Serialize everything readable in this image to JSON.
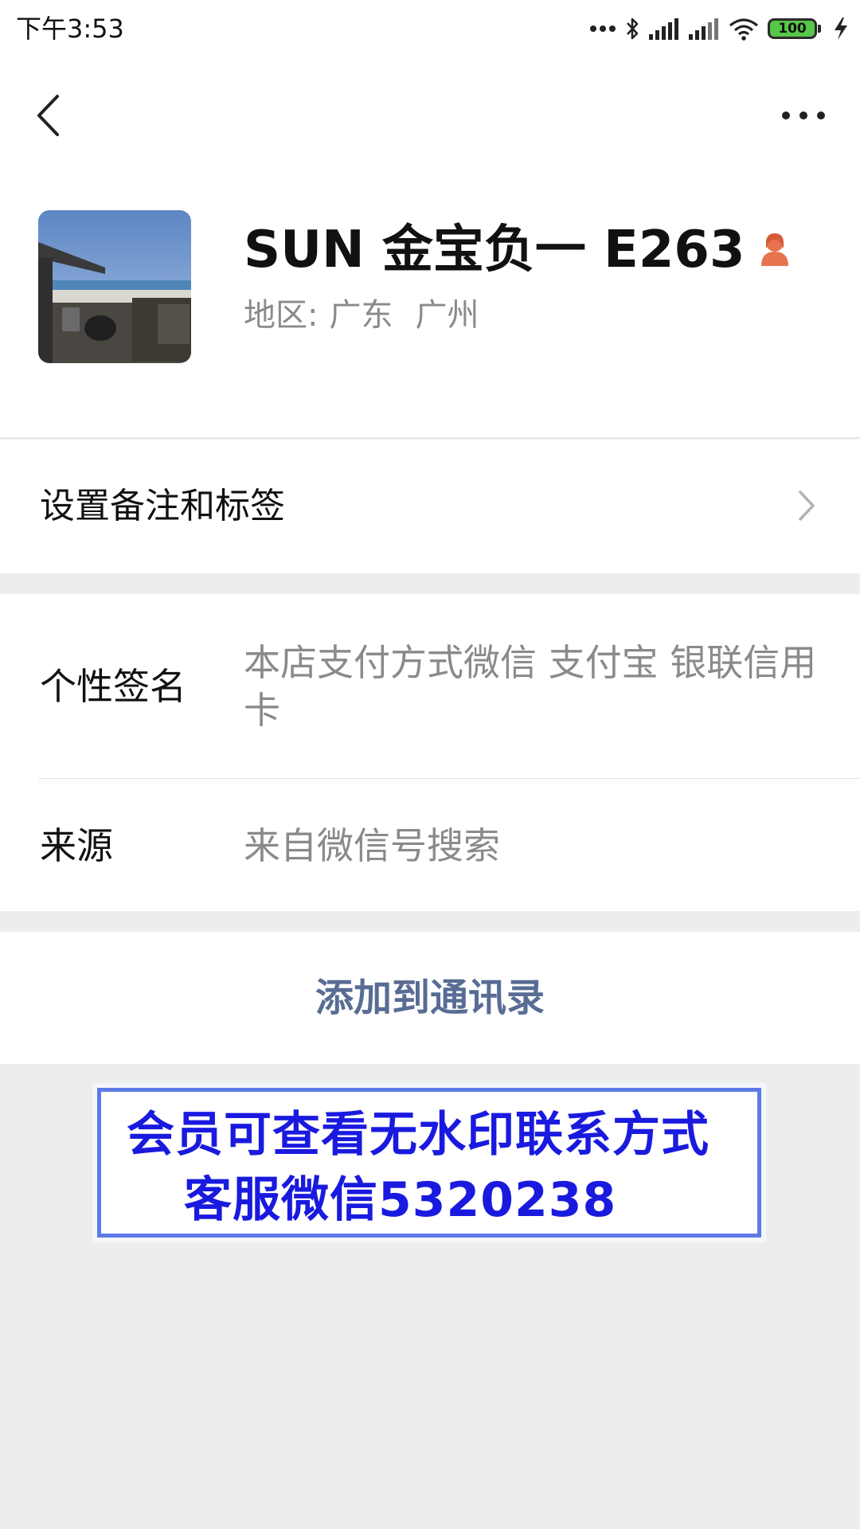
{
  "status_bar": {
    "time": "下午3:53",
    "battery": "100",
    "icons": [
      "dots-icon",
      "bluetooth-icon",
      "signal-icon",
      "signal-icon",
      "wifi-icon",
      "battery-icon",
      "charging-icon"
    ]
  },
  "nav": {
    "back_icon": "chevron-left-icon",
    "more_icon": "more-dots-icon"
  },
  "profile": {
    "name": "SUN 金宝负一 E263",
    "gender_icon": "female-icon",
    "region_label": "地区:",
    "region_province": "广东",
    "region_city": "广州",
    "gender_color": "#e8734f"
  },
  "remark": {
    "label": "设置备注和标签"
  },
  "info": {
    "signature_label": "个性签名",
    "signature_value": "本店支付方式微信 支付宝 银联信用卡",
    "source_label": "来源",
    "source_value": "来自微信号搜索"
  },
  "add_contact": {
    "label": "添加到通讯录",
    "color": "#586c94"
  },
  "watermark": {
    "line1": "会员可查看无水印联系方式",
    "line2": "客服微信5320238",
    "text_color": "#1a1adf",
    "border_color": "#5d7be6"
  }
}
